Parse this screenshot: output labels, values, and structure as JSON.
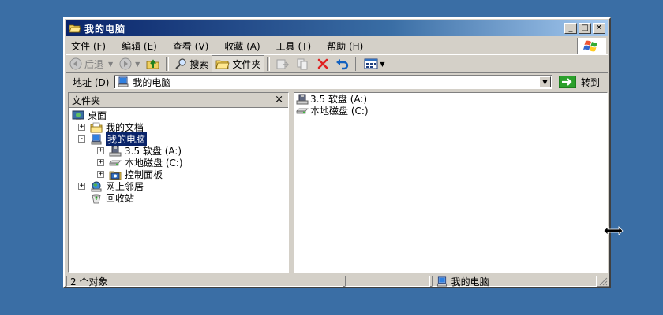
{
  "window": {
    "title": "我的电脑",
    "buttons": {
      "minimize": "_",
      "maximize": "□",
      "close": "✕"
    }
  },
  "menu": [
    "文件 (F)",
    "编辑 (E)",
    "查看 (V)",
    "收藏 (A)",
    "工具 (T)",
    "帮助 (H)"
  ],
  "toolbar": {
    "back": "后退",
    "search": "搜索",
    "folders": "文件夹"
  },
  "address": {
    "label": "地址 (D)",
    "value": "我的电脑",
    "go": "转到"
  },
  "folders_pane": {
    "title": "文件夹",
    "close": "×",
    "tree": [
      {
        "label": "桌面",
        "expander": "",
        "icon": "desktop-icon"
      },
      {
        "label": "我的文档",
        "expander": "+",
        "icon": "my-documents-icon"
      },
      {
        "label": "我的电脑",
        "expander": "-",
        "icon": "my-computer-icon",
        "selected": true
      },
      {
        "label": "3.5 软盘 (A:)",
        "expander": "+",
        "icon": "floppy-icon"
      },
      {
        "label": "本地磁盘 (C:)",
        "expander": "+",
        "icon": "hard-disk-icon"
      },
      {
        "label": "控制面板",
        "expander": "+",
        "icon": "control-panel-icon"
      },
      {
        "label": "网上邻居",
        "expander": "+",
        "icon": "network-icon"
      },
      {
        "label": "回收站",
        "expander": "",
        "icon": "recycle-bin-icon"
      }
    ]
  },
  "content": {
    "items": [
      {
        "label": "3.5 软盘 (A:)",
        "icon": "floppy-icon"
      },
      {
        "label": "本地磁盘 (C:)",
        "icon": "hard-disk-icon"
      }
    ]
  },
  "status": {
    "count": "2 个对象",
    "location": "我的电脑"
  },
  "colors": {
    "desktop": "#3a6ea5",
    "titlebar": "#0a246a",
    "face": "#d4d0c8",
    "selection": "#0a246a"
  }
}
